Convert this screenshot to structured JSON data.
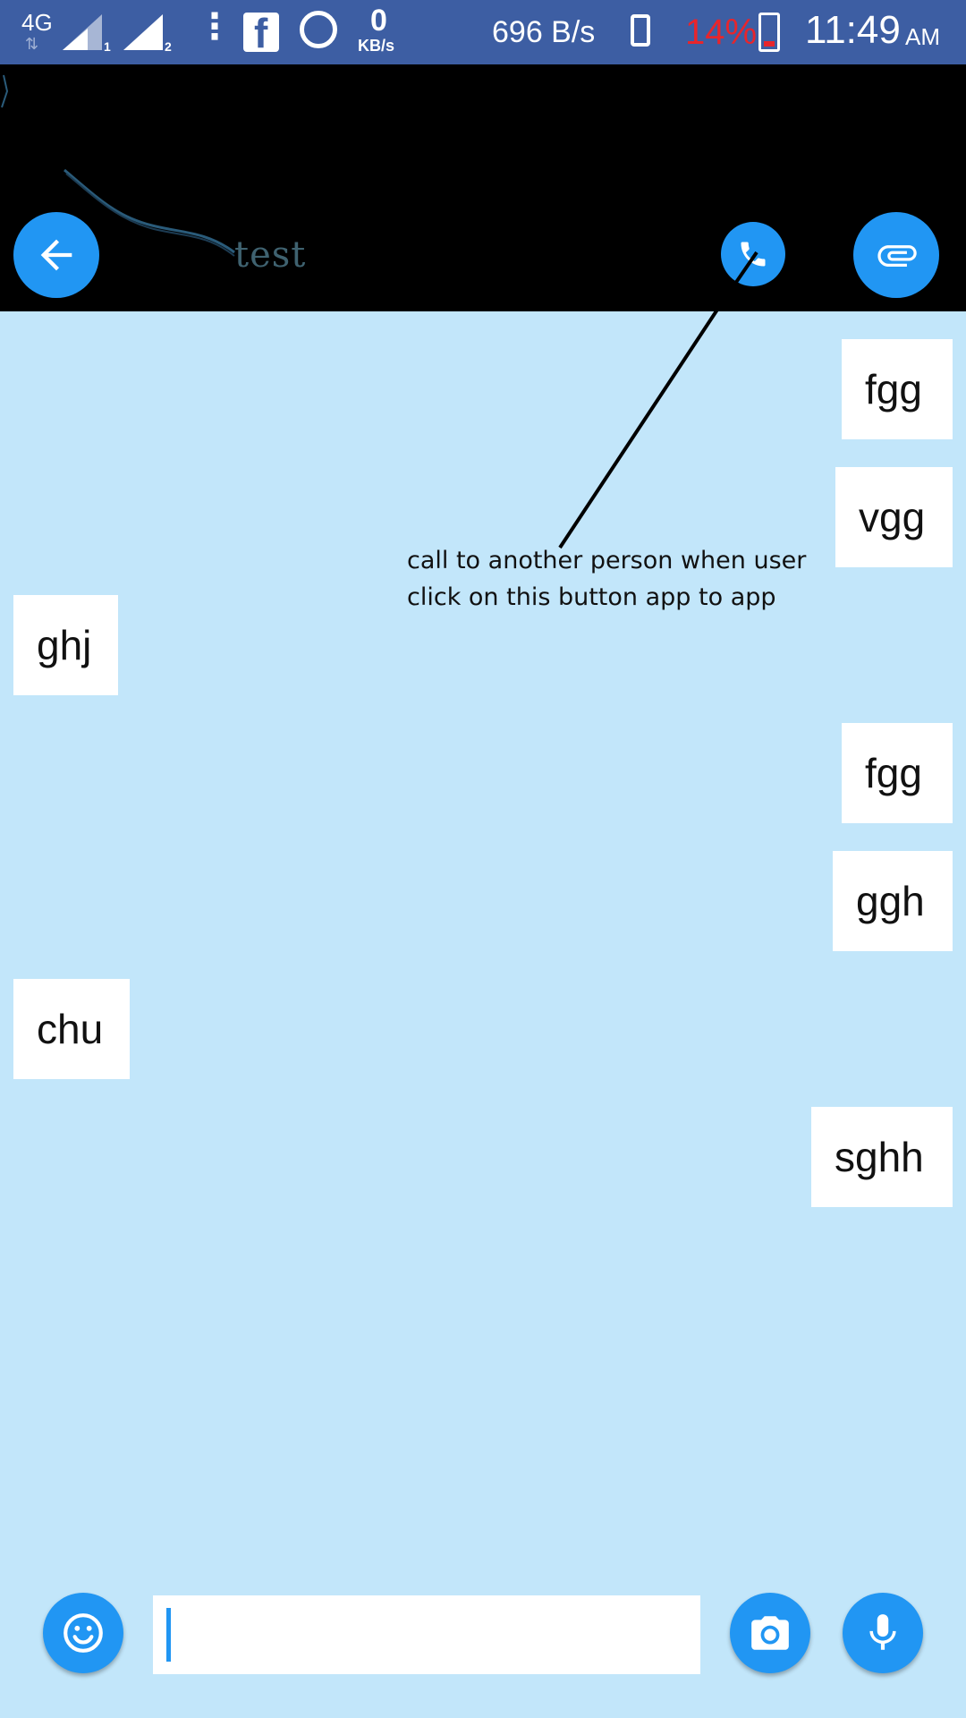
{
  "status_bar": {
    "network": "4G",
    "sim1": "1",
    "sim2": "2",
    "data_speed_value": "0",
    "data_speed_unit": "KB/s",
    "transfer_rate": "696 B/s",
    "battery_percent": "14%",
    "time": "11:49",
    "am_pm": "AM",
    "icons": [
      "signal-icon",
      "facebook-icon",
      "whatsapp-icon",
      "vibrate-icon",
      "battery-charging-icon"
    ]
  },
  "header": {
    "contact_name": "test",
    "back_icon": "arrow-left-icon",
    "call_icon": "phone-icon",
    "attach_icon": "paperclip-icon"
  },
  "messages": [
    {
      "text": "fgg",
      "side": "right"
    },
    {
      "text": "vgg",
      "side": "right"
    },
    {
      "text": "ghj",
      "side": "left"
    },
    {
      "text": "fgg",
      "side": "right"
    },
    {
      "text": "ggh",
      "side": "right"
    },
    {
      "text": "chu",
      "side": "left"
    },
    {
      "text": "sghh",
      "side": "right"
    }
  ],
  "annotation": {
    "line1": "call to another person when user",
    "line2": "click  on this button app to app"
  },
  "composer": {
    "value": "",
    "emoji_icon": "smiley-icon",
    "camera_icon": "camera-icon",
    "mic_icon": "microphone-icon"
  },
  "colors": {
    "status_bar": "#3d5ea3",
    "header": "#000000",
    "chat_background": "#c2e6fa",
    "accent": "#2196f3",
    "battery_low": "#e8252c"
  }
}
